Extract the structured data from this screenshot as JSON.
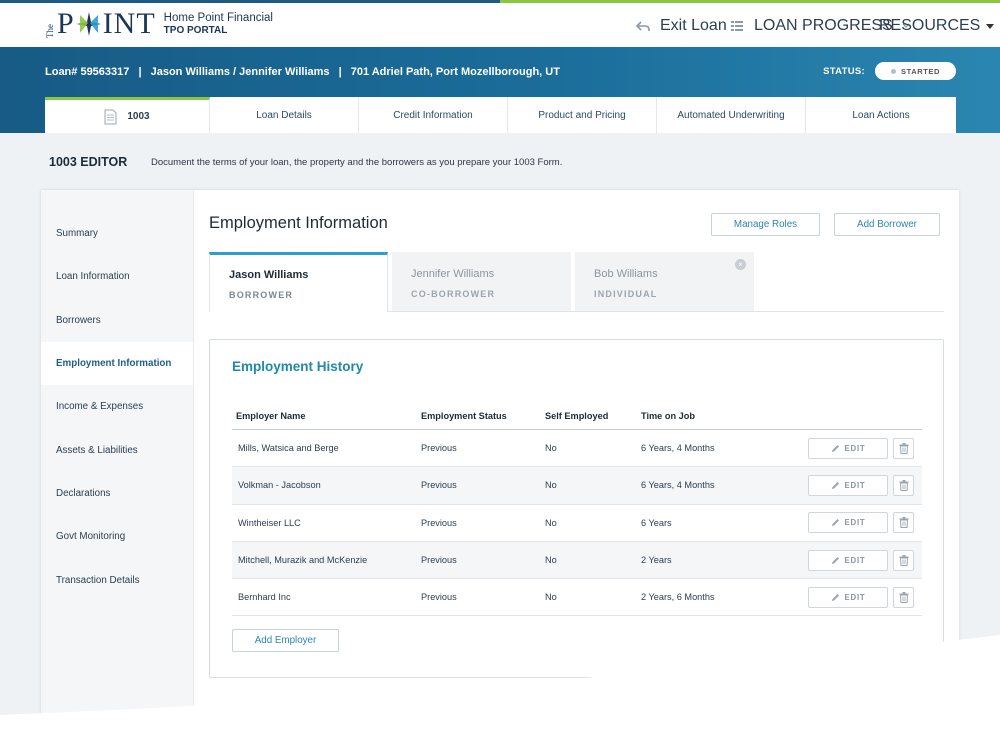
{
  "header": {
    "logo": {
      "the": "The",
      "point": "POINT",
      "brand_line1": "Home Point Financial",
      "brand_line2": "TPO PORTAL"
    },
    "exit_loan": "Exit Loan",
    "loan_progress": "LOAN PROGRESS",
    "resources": "RESOURCES"
  },
  "loan": {
    "number": "Loan# 59563317",
    "sep1": "|",
    "borrowers": "Jason Williams / Jennifer Williams",
    "sep2": "|",
    "address": "701 Adriel Path, Port Mozellborough, UT",
    "status_label": "STATUS:",
    "status_value": "STARTED"
  },
  "tabs": [
    {
      "label": "1003"
    },
    {
      "label": "Loan Details"
    },
    {
      "label": "Credit Information"
    },
    {
      "label": "Product and Pricing"
    },
    {
      "label": "Automated Underwriting"
    },
    {
      "label": "Loan Actions"
    }
  ],
  "editor": {
    "title": "1003 EDITOR",
    "description": "Document the terms of your loan, the property and the borrowers as you prepare your 1003 Form."
  },
  "sidebar": {
    "items": [
      {
        "label": "Summary"
      },
      {
        "label": "Loan Information"
      },
      {
        "label": "Borrowers"
      },
      {
        "label": "Employment Information"
      },
      {
        "label": "Income & Expenses"
      },
      {
        "label": "Assets & Liabilities"
      },
      {
        "label": "Declarations"
      },
      {
        "label": "Govt Monitoring"
      },
      {
        "label": "Transaction Details"
      }
    ]
  },
  "main": {
    "title": "Employment Information",
    "manage_roles": "Manage Roles",
    "add_borrower": "Add Borrower",
    "borrower_tabs": [
      {
        "name": "Jason Williams",
        "role": "BORROWER"
      },
      {
        "name": "Jennifer Williams",
        "role": "CO-BORROWER"
      },
      {
        "name": "Bob Williams",
        "role": "INDIVIDUAL"
      }
    ],
    "history": {
      "title": "Employment History",
      "columns": [
        "Employer Name",
        "Employment Status",
        "Self Employed",
        "Time on Job"
      ],
      "rows": [
        {
          "employer": "Mills, Watsica and Berge",
          "status": "Previous",
          "self_employed": "No",
          "time": "6 Years, 4 Months"
        },
        {
          "employer": "Volkman - Jacobson",
          "status": "Previous",
          "self_employed": "No",
          "time": "6 Years, 4 Months"
        },
        {
          "employer": "Wintheiser LLC",
          "status": "Previous",
          "self_employed": "No",
          "time": "6 Years"
        },
        {
          "employer": "Mitchell, Murazik and McKenzie",
          "status": "Previous",
          "self_employed": "No",
          "time": "2 Years"
        },
        {
          "employer": "Bernhard Inc",
          "status": "Previous",
          "self_employed": "No",
          "time": "2 Years, 6 Months"
        }
      ],
      "edit_label": "EDIT",
      "add_employer": "Add Employer"
    }
  },
  "colors": {
    "brand_navy": "#1d3557",
    "brand_green": "#8cc63f",
    "band_blue": "#175b86",
    "accent_teal": "#1f8aa8",
    "active_nav": "#1f5f8b"
  },
  "icons": {
    "exit": "undo-arrow-icon",
    "progress": "list-icon",
    "tab_1003": "document-icon",
    "edit": "pencil-icon",
    "delete": "trash-icon",
    "close": "close-icon"
  }
}
